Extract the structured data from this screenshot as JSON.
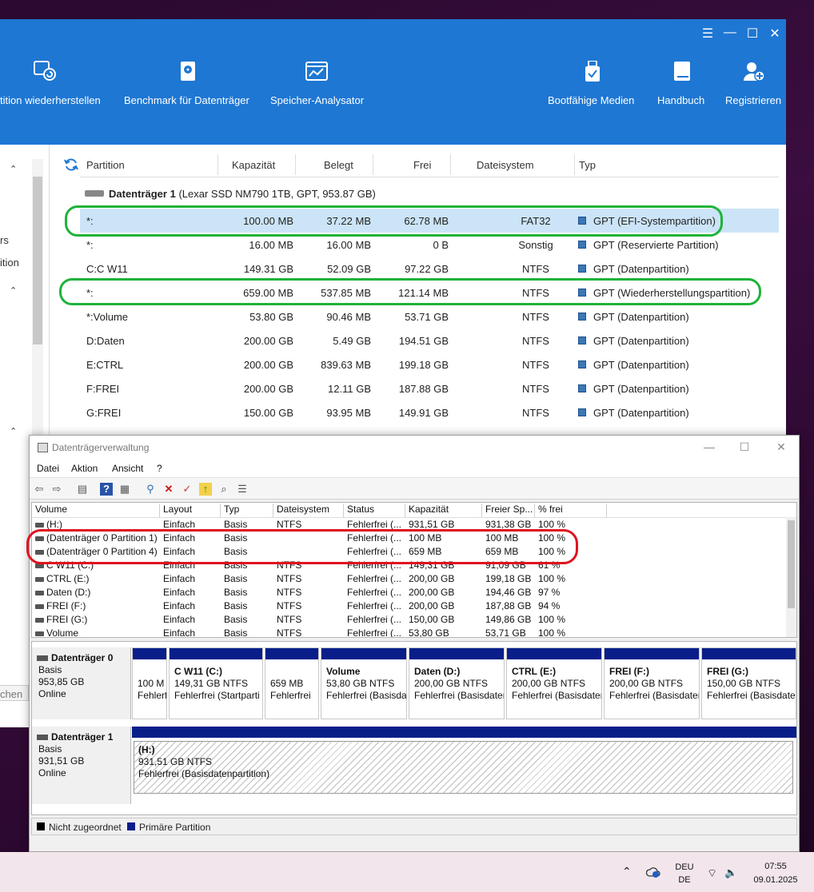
{
  "bgapp": {
    "window_controls": [
      "☰",
      "—",
      "☐",
      "✕"
    ],
    "toolbar": [
      {
        "label": "tition wiederherstellen",
        "icon": "partition-recovery-icon"
      },
      {
        "label": "Benchmark für Datenträger",
        "icon": "disk-benchmark-icon"
      },
      {
        "label": "Speicher-Analysator",
        "icon": "space-analyzer-icon"
      },
      {
        "label": "Bootfähige Medien",
        "icon": "bootable-media-icon"
      },
      {
        "label": "Handbuch",
        "icon": "manual-book-icon"
      },
      {
        "label": "Registrieren",
        "icon": "register-user-icon"
      }
    ],
    "sidebar_fragments": [
      "rs",
      "ition",
      "chen"
    ],
    "columns": [
      "Partition",
      "Kapazität",
      "Belegt",
      "Frei",
      "Dateisystem",
      "Typ"
    ],
    "disk_name": "Datenträger 1",
    "disk_info": "(Lexar SSD NM790 1TB, GPT, 953.87 GB)",
    "rows": [
      {
        "name": "*:",
        "cap": "100.00 MB",
        "used": "37.22 MB",
        "free": "62.78 MB",
        "fs": "FAT32",
        "type": "GPT (EFI-Systempartition)"
      },
      {
        "name": "*:",
        "cap": "16.00 MB",
        "used": "16.00 MB",
        "free": "0 B",
        "fs": "Sonstig",
        "type": "GPT (Reservierte Partition)"
      },
      {
        "name": "C:C W11",
        "cap": "149.31 GB",
        "used": "52.09 GB",
        "free": "97.22 GB",
        "fs": "NTFS",
        "type": "GPT (Datenpartition)"
      },
      {
        "name": "*:",
        "cap": "659.00 MB",
        "used": "537.85 MB",
        "free": "121.14 MB",
        "fs": "NTFS",
        "type": "GPT (Wiederherstellungspartition)"
      },
      {
        "name": "*:Volume",
        "cap": "53.80 GB",
        "used": "90.46 MB",
        "free": "53.71 GB",
        "fs": "NTFS",
        "type": "GPT (Datenpartition)"
      },
      {
        "name": "D:Daten",
        "cap": "200.00 GB",
        "used": "5.49 GB",
        "free": "194.51 GB",
        "fs": "NTFS",
        "type": "GPT (Datenpartition)"
      },
      {
        "name": "E:CTRL",
        "cap": "200.00 GB",
        "used": "839.63 MB",
        "free": "199.18 GB",
        "fs": "NTFS",
        "type": "GPT (Datenpartition)"
      },
      {
        "name": "F:FREI",
        "cap": "200.00 GB",
        "used": "12.11 GB",
        "free": "187.88 GB",
        "fs": "NTFS",
        "type": "GPT (Datenpartition)"
      },
      {
        "name": "G:FREI",
        "cap": "150.00 GB",
        "used": "93.95 MB",
        "free": "149.91 GB",
        "fs": "NTFS",
        "type": "GPT (Datenpartition)"
      }
    ]
  },
  "dm": {
    "title": "Datenträgerverwaltung",
    "window_controls": [
      "—",
      "☐",
      "✕"
    ],
    "menu": [
      "Datei",
      "Aktion",
      "Ansicht",
      "?"
    ],
    "columns": [
      "Volume",
      "Layout",
      "Typ",
      "Dateisystem",
      "Status",
      "Kapazität",
      "Freier Sp...",
      "% frei"
    ],
    "volumes": [
      {
        "vol": "(H:)",
        "layout": "Einfach",
        "typ": "Basis",
        "fs": "NTFS",
        "status": "Fehlerfrei (...",
        "cap": "931,51 GB",
        "free": "931,38 GB",
        "pct": "100 %"
      },
      {
        "vol": "(Datenträger 0 Partition 1)",
        "layout": "Einfach",
        "typ": "Basis",
        "fs": "",
        "status": "Fehlerfrei (...",
        "cap": "100 MB",
        "free": "100 MB",
        "pct": "100 %"
      },
      {
        "vol": "(Datenträger 0 Partition 4)",
        "layout": "Einfach",
        "typ": "Basis",
        "fs": "",
        "status": "Fehlerfrei (...",
        "cap": "659 MB",
        "free": "659 MB",
        "pct": "100 %"
      },
      {
        "vol": "C W11 (C:)",
        "layout": "Einfach",
        "typ": "Basis",
        "fs": "NTFS",
        "status": "Fehlerfrei (...",
        "cap": "149,31 GB",
        "free": "91,09 GB",
        "pct": "61 %"
      },
      {
        "vol": "CTRL (E:)",
        "layout": "Einfach",
        "typ": "Basis",
        "fs": "NTFS",
        "status": "Fehlerfrei (...",
        "cap": "200,00 GB",
        "free": "199,18 GB",
        "pct": "100 %"
      },
      {
        "vol": "Daten (D:)",
        "layout": "Einfach",
        "typ": "Basis",
        "fs": "NTFS",
        "status": "Fehlerfrei (...",
        "cap": "200,00 GB",
        "free": "194,46 GB",
        "pct": "97 %"
      },
      {
        "vol": "FREI (F:)",
        "layout": "Einfach",
        "typ": "Basis",
        "fs": "NTFS",
        "status": "Fehlerfrei (...",
        "cap": "200,00 GB",
        "free": "187,88 GB",
        "pct": "94 %"
      },
      {
        "vol": "FREI (G:)",
        "layout": "Einfach",
        "typ": "Basis",
        "fs": "NTFS",
        "status": "Fehlerfrei (...",
        "cap": "150,00 GB",
        "free": "149,86 GB",
        "pct": "100 %"
      },
      {
        "vol": "Volume",
        "layout": "Einfach",
        "typ": "Basis",
        "fs": "NTFS",
        "status": "Fehlerfrei (...",
        "cap": "53,80 GB",
        "free": "53,71 GB",
        "pct": "100 %"
      }
    ],
    "disk0": {
      "name": "Datenträger 0",
      "kind": "Basis",
      "size": "953,85 GB",
      "state": "Online",
      "parts": [
        {
          "title": "",
          "size": "100 M",
          "status": "Fehlerf"
        },
        {
          "title": "C W11  (C:)",
          "size": "149,31 GB NTFS",
          "status": "Fehlerfrei (Startparti"
        },
        {
          "title": "",
          "size": "659 MB",
          "status": "Fehlerfrei"
        },
        {
          "title": "Volume",
          "size": "53,80 GB NTFS",
          "status": "Fehlerfrei (Basisda"
        },
        {
          "title": "Daten  (D:)",
          "size": "200,00 GB NTFS",
          "status": "Fehlerfrei (Basisdater"
        },
        {
          "title": "CTRL  (E:)",
          "size": "200,00 GB NTFS",
          "status": "Fehlerfrei (Basisdater"
        },
        {
          "title": "FREI  (F:)",
          "size": "200,00 GB NTFS",
          "status": "Fehlerfrei (Basisdater"
        },
        {
          "title": "FREI  (G:)",
          "size": "150,00 GB NTFS",
          "status": "Fehlerfrei (Basisdater"
        }
      ]
    },
    "disk1": {
      "name": "Datenträger 1",
      "kind": "Basis",
      "size": "931,51 GB",
      "state": "Online",
      "part": {
        "title": "(H:)",
        "size": "931,51 GB NTFS",
        "status": "Fehlerfrei (Basisdatenpartition)"
      }
    },
    "legend": [
      {
        "label": "Nicht zugeordnet",
        "color": "#000000"
      },
      {
        "label": "Primäre Partition",
        "color": "#0a1e8a"
      }
    ]
  },
  "taskbar": {
    "lang_top": "DEU",
    "lang_bottom": "DE",
    "time": "07:55",
    "date": "09.01.2025"
  },
  "colors": {
    "accent": "#1e77d3",
    "selection": "#cce4f7",
    "highlight_green": "#1fb33a",
    "highlight_red": "#e0121f",
    "primary_partition": "#0a1e8a"
  }
}
